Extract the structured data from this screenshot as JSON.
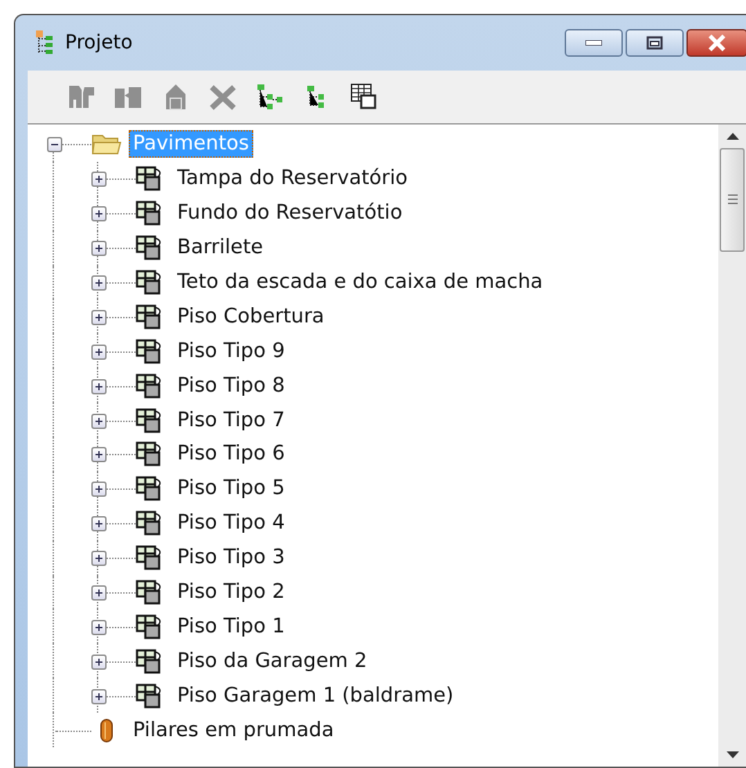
{
  "window": {
    "title": "Projeto"
  },
  "toolbar": [
    {
      "kind": "add",
      "disabled": true
    },
    {
      "kind": "move",
      "disabled": true
    },
    {
      "kind": "copy",
      "disabled": true
    },
    {
      "kind": "delete",
      "disabled": true
    },
    {
      "kind": "expand",
      "disabled": false
    },
    {
      "kind": "collapse",
      "disabled": false
    },
    {
      "kind": "table",
      "disabled": false
    }
  ],
  "tree": [
    {
      "label": "Pavimentos",
      "kind": "folder",
      "expanded": true,
      "selected": true,
      "children": [
        {
          "label": "Tampa do Reservatório",
          "kind": "floor",
          "expanded": false,
          "selected": false
        },
        {
          "label": "Fundo do Reservatótio",
          "kind": "floor",
          "expanded": false,
          "selected": false
        },
        {
          "label": "Barrilete",
          "kind": "floor",
          "expanded": false,
          "selected": false
        },
        {
          "label": "Teto da escada e do caixa de macha",
          "kind": "floor",
          "expanded": false,
          "selected": false
        },
        {
          "label": "Piso Cobertura",
          "kind": "floor",
          "expanded": false,
          "selected": false
        },
        {
          "label": "Piso Tipo 9",
          "kind": "floor",
          "expanded": false,
          "selected": false
        },
        {
          "label": "Piso Tipo 8",
          "kind": "floor",
          "expanded": false,
          "selected": false
        },
        {
          "label": "Piso Tipo 7",
          "kind": "floor",
          "expanded": false,
          "selected": false
        },
        {
          "label": "Piso Tipo 6",
          "kind": "floor",
          "expanded": false,
          "selected": false
        },
        {
          "label": "Piso Tipo 5",
          "kind": "floor",
          "expanded": false,
          "selected": false
        },
        {
          "label": "Piso Tipo 4",
          "kind": "floor",
          "expanded": false,
          "selected": false
        },
        {
          "label": "Piso Tipo 3",
          "kind": "floor",
          "expanded": false,
          "selected": false
        },
        {
          "label": "Piso Tipo 2",
          "kind": "floor",
          "expanded": false,
          "selected": false
        },
        {
          "label": "Piso Tipo 1",
          "kind": "floor",
          "expanded": false,
          "selected": false
        },
        {
          "label": "Piso da Garagem 2",
          "kind": "floor",
          "expanded": false,
          "selected": false
        },
        {
          "label": "Piso Garagem 1 (baldrame)",
          "kind": "floor",
          "expanded": false,
          "selected": false
        }
      ]
    },
    {
      "label": "Pilares em prumada",
      "kind": "pillar",
      "selected": false
    }
  ]
}
